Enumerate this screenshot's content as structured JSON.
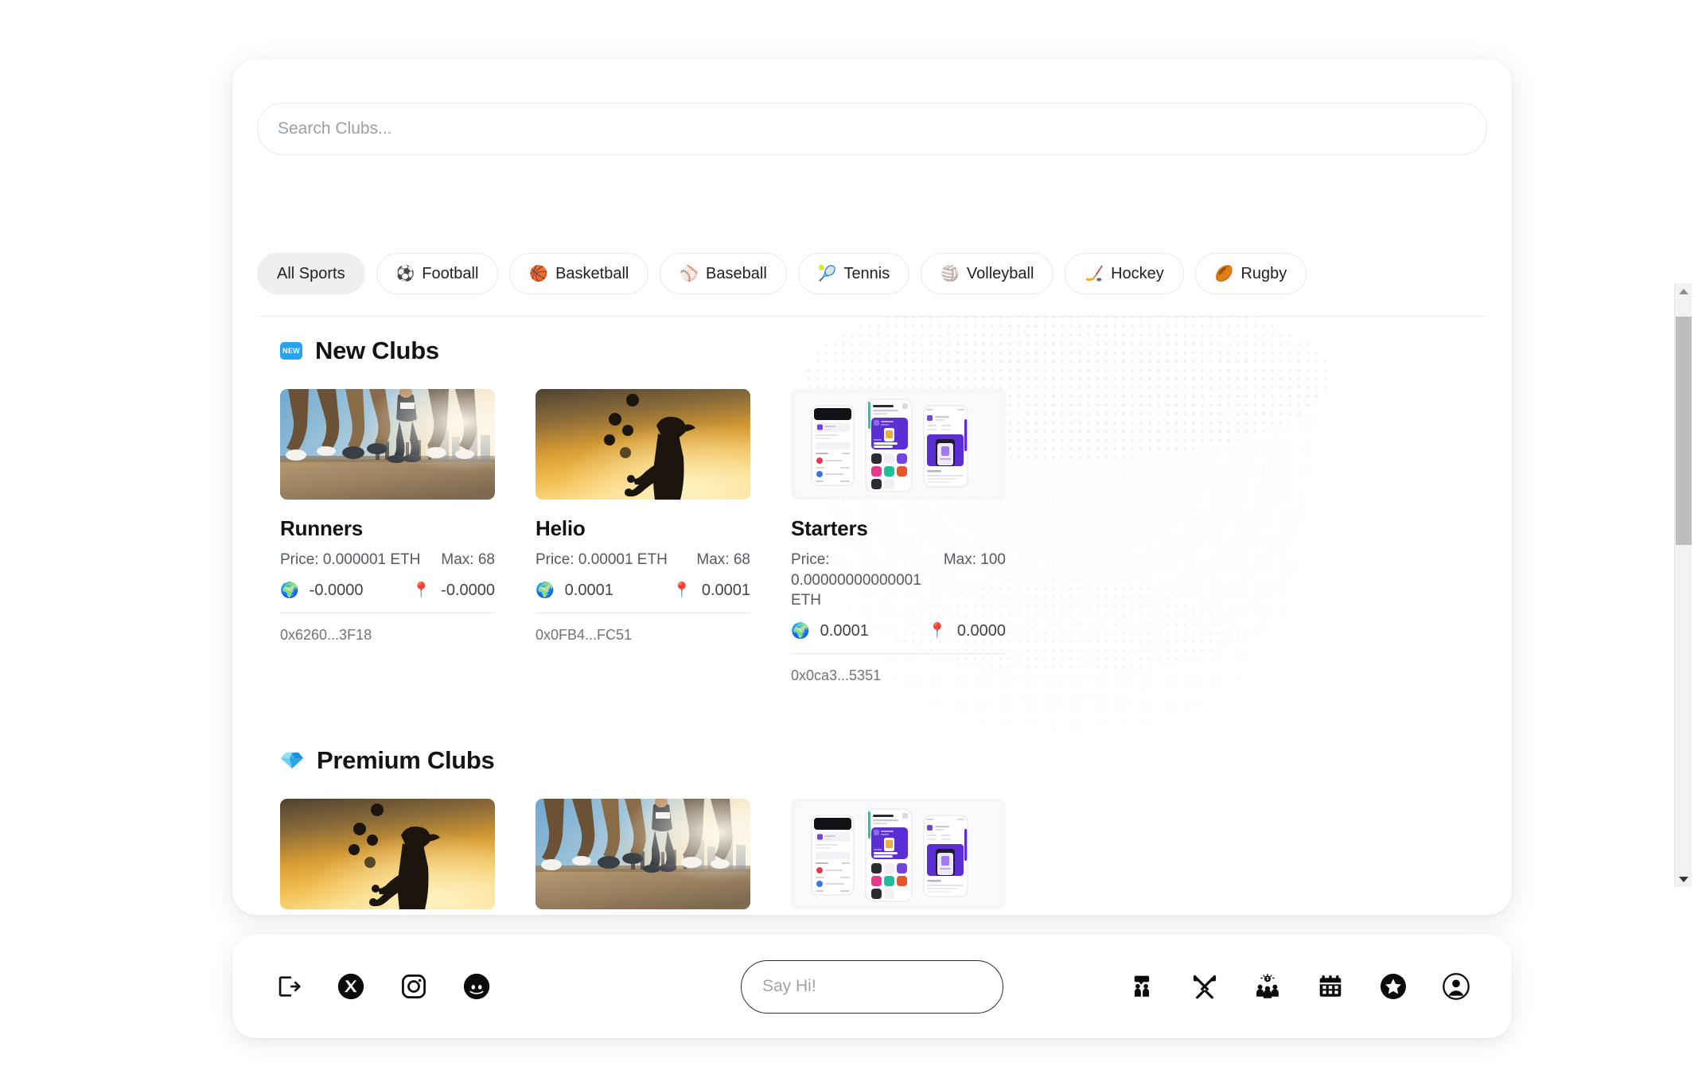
{
  "search": {
    "placeholder": "Search Clubs...",
    "value": ""
  },
  "filters": {
    "items": [
      {
        "label": "All Sports",
        "emoji": "",
        "icon": "all-sports-icon",
        "active": true
      },
      {
        "label": "Football",
        "emoji": "⚽",
        "icon": "football-icon",
        "active": false
      },
      {
        "label": "Basketball",
        "emoji": "🏀",
        "icon": "basketball-icon",
        "active": false
      },
      {
        "label": "Baseball",
        "emoji": "⚾",
        "icon": "baseball-icon",
        "active": false
      },
      {
        "label": "Tennis",
        "emoji": "🎾",
        "icon": "tennis-icon",
        "active": false
      },
      {
        "label": "Volleyball",
        "emoji": "🏐",
        "icon": "volleyball-icon",
        "active": false
      },
      {
        "label": "Hockey",
        "emoji": "🏒",
        "icon": "hockey-icon",
        "active": false
      },
      {
        "label": "Rugby",
        "emoji": "🏉",
        "icon": "rugby-icon",
        "active": false
      }
    ]
  },
  "sections": [
    {
      "title": "New Clubs",
      "badge": "NEW",
      "badge_color": "#29a3ee",
      "icon": "new-badge-icon",
      "cards": [
        {
          "name": "Runners",
          "price": "Price: 0.000001 ETH",
          "max": "Max: 68",
          "stat_globe": "-0.0000",
          "stat_pin": "-0.0000",
          "address": "0x6260...3F18",
          "image": "marathon-runners-photo"
        },
        {
          "name": "Helio",
          "price": "Price: 0.00001 ETH",
          "max": "Max: 68",
          "stat_globe": "0.0001",
          "stat_pin": "0.0001",
          "address": "0x0FB4...FC51",
          "image": "juggler-sunset-silhouette-photo"
        },
        {
          "name": "Starters",
          "price": "Price: 0.00000000000001 ETH",
          "max": "Max: 100",
          "stat_globe": "0.0001",
          "stat_pin": "0.0000",
          "address": "0x0ca3...5351",
          "image": "mobile-app-mockup-photo"
        }
      ]
    },
    {
      "title": "Premium Clubs",
      "badge": "",
      "badge_color": "#3ab7f0",
      "icon": "gem-icon",
      "cards": [
        {
          "name": "",
          "price": "",
          "max": "",
          "stat_globe": "",
          "stat_pin": "",
          "address": "",
          "image": "juggler-sunset-silhouette-photo"
        },
        {
          "name": "",
          "price": "",
          "max": "",
          "stat_globe": "",
          "stat_pin": "",
          "address": "",
          "image": "marathon-runners-photo"
        },
        {
          "name": "",
          "price": "",
          "max": "",
          "stat_globe": "",
          "stat_pin": "",
          "address": "",
          "image": "mobile-app-mockup-photo"
        }
      ]
    }
  ],
  "stat_icons": {
    "globe": "🌍",
    "pin": "📍"
  },
  "dock": {
    "left_icons": [
      {
        "name": "logout-icon",
        "label": "Logout"
      },
      {
        "name": "x-twitter-icon",
        "label": "X"
      },
      {
        "name": "instagram-icon",
        "label": "Instagram"
      },
      {
        "name": "discord-icon",
        "label": "Discord"
      }
    ],
    "right_icons": [
      {
        "name": "members-chat-icon",
        "label": "Members"
      },
      {
        "name": "crossed-swords-icon",
        "label": "Battles"
      },
      {
        "name": "funding-group-icon",
        "label": "Funding"
      },
      {
        "name": "calendar-icon",
        "label": "Calendar"
      },
      {
        "name": "star-icon",
        "label": "Favorites"
      },
      {
        "name": "user-profile-icon",
        "label": "Profile"
      }
    ],
    "chat": {
      "placeholder": "Say Hi!",
      "value": ""
    }
  },
  "scrollbar": {
    "thumb_top_pct": "3",
    "thumb_height_pct": "40"
  }
}
